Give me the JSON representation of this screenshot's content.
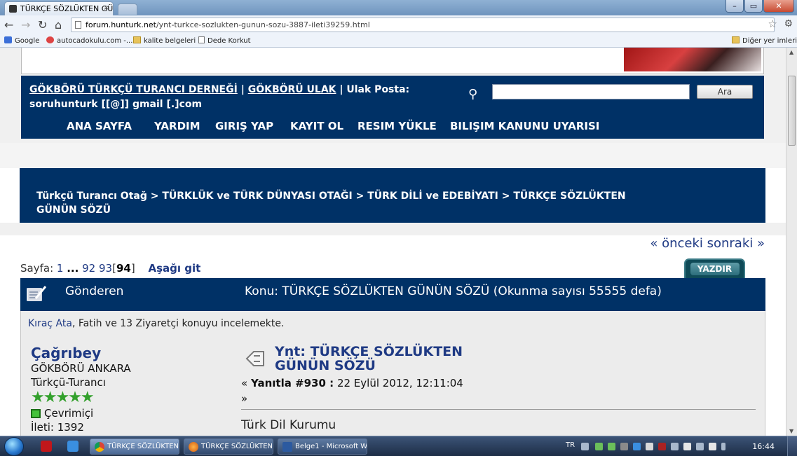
{
  "browser": {
    "tab_title": "TÜRKÇE SÖZLÜKTEN GÜN",
    "tab_close": "×",
    "url_domain": "forum.hunturk.net",
    "url_path": "/ynt-turkce-sozlukten-gunun-sozu-3887-ileti39259.html",
    "window_min": "–",
    "window_max": "▭",
    "window_close": "✕",
    "nav_back": "←",
    "nav_forward": "→",
    "nav_reload": "↻",
    "nav_home": "⌂",
    "star": "☆",
    "wrench": "⚙"
  },
  "bookmarks": {
    "items": [
      {
        "label": "Google",
        "icon": "google-icon"
      },
      {
        "label": "autocadokulu.com -...",
        "icon": "at-icon"
      },
      {
        "label": "kalite belgeleri",
        "icon": "folder-icon"
      },
      {
        "label": "Dede Korkut",
        "icon": "page-icon"
      }
    ],
    "other": "Diğer yer imleri"
  },
  "header": {
    "org_link": "GÖKBÖRÜ TÜRKÇÜ TURANCI DERNEĞİ",
    "separator": "|",
    "ulak_link": "GÖKBÖRÜ ULAK",
    "mail_text": "| Ulak Posta: soruhunturk [[@]] gmail [.]com",
    "search_value": "",
    "search_button": "Ara"
  },
  "menu": {
    "items": [
      "ANA SAYFA",
      "YARDIM",
      "GIRIŞ YAP",
      "KAYIT OL",
      "RESIM YÜKLE",
      "BILIŞIM KANUNU UYARISI"
    ]
  },
  "breadcrumb": {
    "text": "Türkçü Turancı Otağ > TÜRKLÜK ve TÜRK DÜNYASI OTAĞI > TÜRK DİLİ ve EDEBİYATI > TÜRKÇE SÖZLÜKTEN GÜNÜN SÖZÜ"
  },
  "prev_next": "« önceki sonraki »",
  "pager": {
    "label": "Sayfa:",
    "first": "1",
    "ellipsis": "...",
    "p92": "92",
    "p93": "93",
    "current_open": "[",
    "current": "94",
    "current_close": "]",
    "go_down": "Aşağı git"
  },
  "print_button": "YAZDIR",
  "post_header": {
    "sender_label": "Gönderen",
    "topic": "Konu: TÜRKÇE SÖZLÜKTEN GÜNÜN SÖZÜ  (Okunma sayısı 55555 defa)"
  },
  "viewing": {
    "user": "Kıraç Ata",
    "rest": ", Fatih ve 13 Ziyaretçi konuyu incelemekte."
  },
  "poster": {
    "name": "Çağrıbey",
    "group": "GÖKBÖRÜ ANKARA",
    "title": "Türkçü-Turancı",
    "stars": "★★★★★",
    "rating": 5,
    "status": "Çevrimiçi",
    "posts": "İleti: 1392"
  },
  "message": {
    "title": "Ynt: TÜRKÇE SÖZLÜKTEN GÜNÜN SÖZÜ",
    "reply_prefix": "«",
    "reply_label": "Yanıtla #930 :",
    "date": "22 Eylül 2012, 12:11:04",
    "reply_suffix": "»",
    "body_first_line": "Türk Dil Kurumu"
  },
  "taskbar": {
    "buttons": [
      {
        "label": "TÜRKÇE SÖZLÜKTEN..."
      },
      {
        "label": "TÜRKÇE SÖZLÜKTEN..."
      },
      {
        "label": "Belge1 - Microsoft W..."
      }
    ],
    "lang": "TR",
    "clock": "16:44"
  },
  "colors": {
    "navy": "#003166",
    "link": "#1f3a84",
    "post_bg": "#ececec"
  }
}
